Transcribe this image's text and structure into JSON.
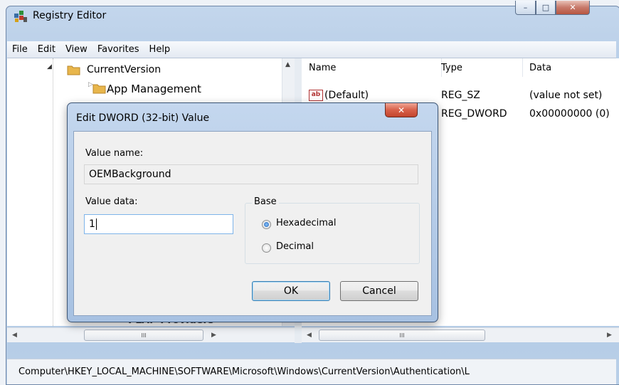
{
  "window": {
    "title": "Registry Editor",
    "caption": {
      "minimize": "–",
      "maximize": "□",
      "close": "✕"
    }
  },
  "menubar": [
    "File",
    "Edit",
    "View",
    "Favorites",
    "Help"
  ],
  "tree": {
    "items": [
      {
        "label": "CurrentVersion",
        "expanded": true
      },
      {
        "label": "App Management",
        "expanded": false
      },
      {
        "label": "PLAP Providers",
        "expanded": false
      }
    ],
    "hscroll_thumb": "III"
  },
  "list": {
    "columns": [
      "Name",
      "Type",
      "Data"
    ],
    "rows": [
      {
        "name": "(Default)",
        "type": "REG_SZ",
        "data": "(value not set)",
        "icon": "string-value-icon"
      },
      {
        "name": "OEMBackground",
        "type": "REG_DWORD",
        "data": "0x00000000 (0)",
        "icon": "dword-value-icon"
      }
    ],
    "hscroll_thumb": "III"
  },
  "status": {
    "path": "Computer\\HKEY_LOCAL_MACHINE\\SOFTWARE\\Microsoft\\Windows\\CurrentVersion\\Authentication\\L"
  },
  "dialog": {
    "title": "Edit DWORD (32-bit) Value",
    "close": "✕",
    "value_name_label": "Value name:",
    "value_name": "OEMBackground",
    "value_data_label": "Value data:",
    "value_data": "1",
    "base_label": "Base",
    "base_options": [
      {
        "label": "Hexadecimal",
        "selected": true
      },
      {
        "label": "Decimal",
        "selected": false
      }
    ],
    "ok_label": "OK",
    "cancel_label": "Cancel"
  },
  "colors": {
    "title_bar": "#b9cfe8",
    "close_button": "#c7442c",
    "selection": "#3399ff"
  }
}
